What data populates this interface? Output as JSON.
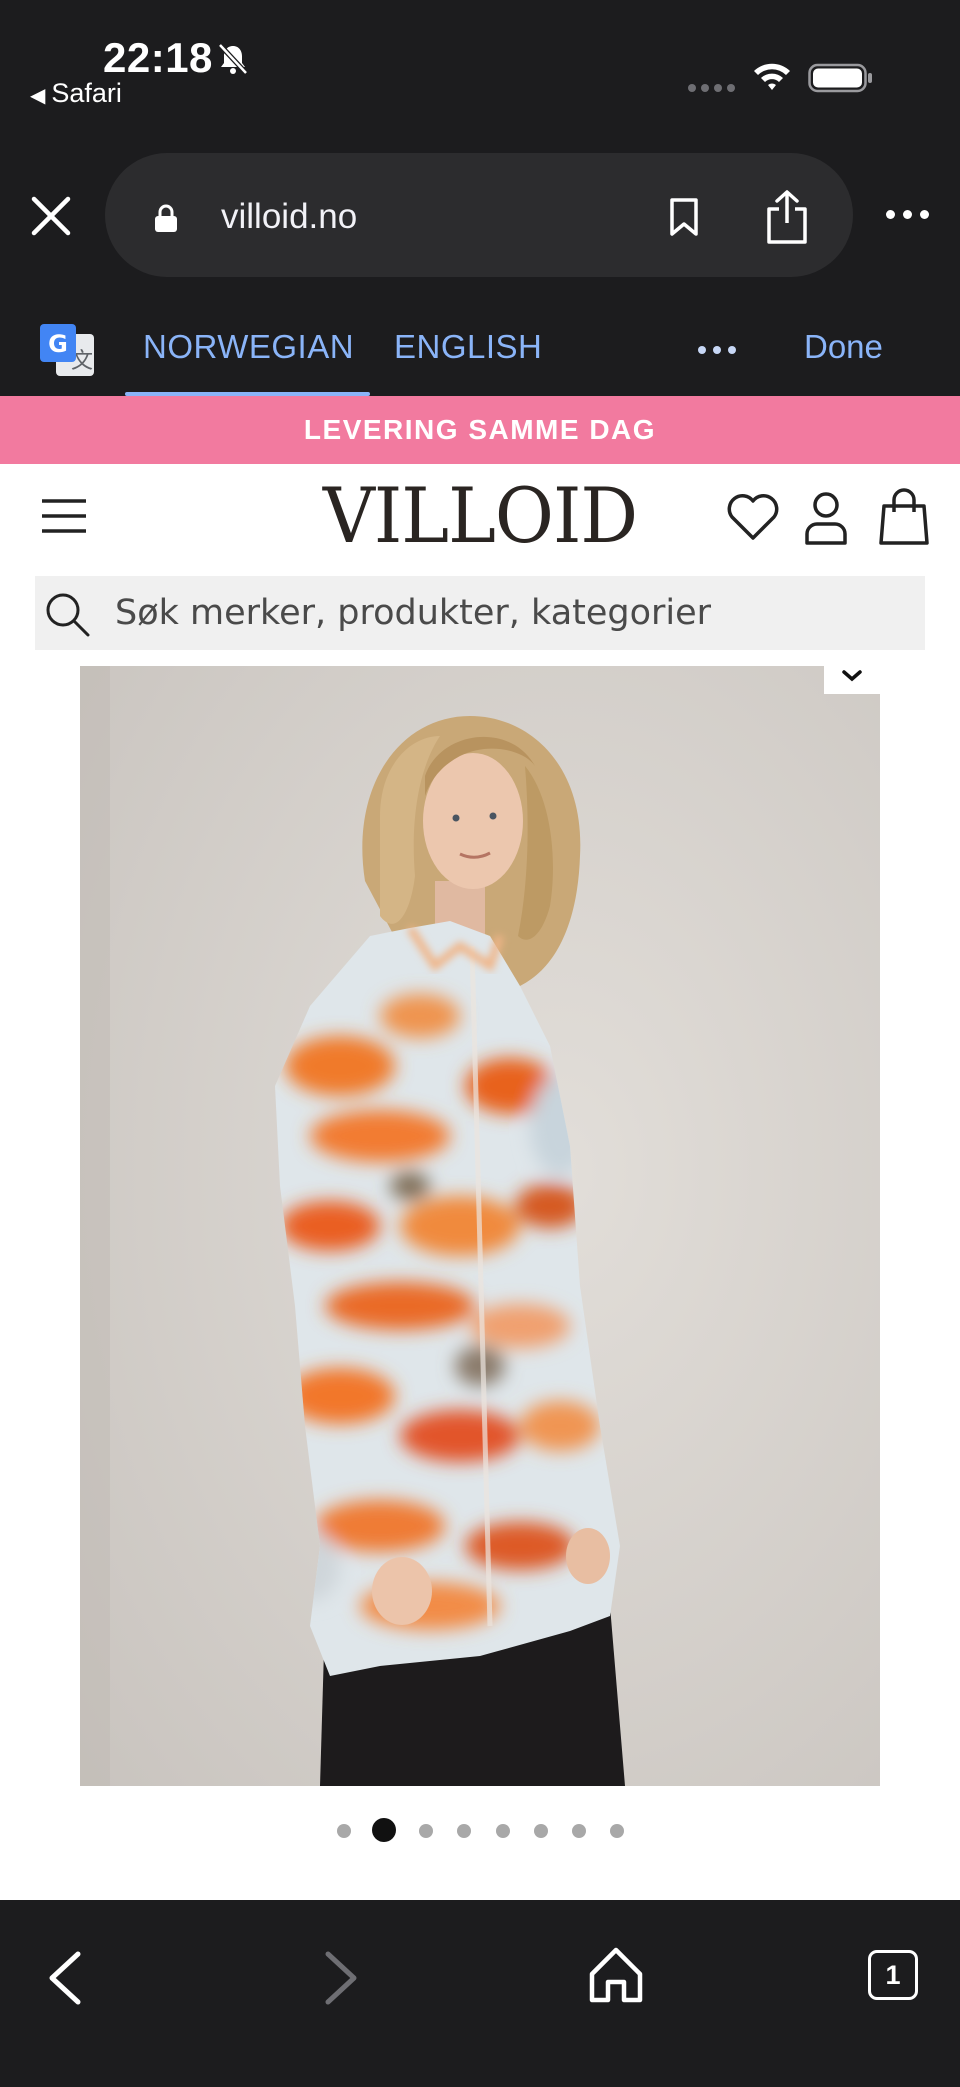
{
  "status_bar": {
    "time": "22:18",
    "back_app_label": "Safari"
  },
  "browser": {
    "url": "villoid.no",
    "open_tabs_count": "1"
  },
  "translate_bar": {
    "source_language": "NORWEGIAN",
    "target_language": "ENGLISH",
    "done_label": "Done"
  },
  "site": {
    "promo_banner": "LEVERING SAMME DAG",
    "logo": "VILLOID",
    "search_placeholder": "Søk merker, produkter, kategorier"
  },
  "product": {
    "image_description_icon": "woman-in-orange-blurred-print-shirt",
    "carousel": {
      "total_slides": 8,
      "active_index": 1
    }
  },
  "colors": {
    "chrome_background": "#1c1c1e",
    "url_pill": "#2c2c2e",
    "translate_accent": "#8ab4f8",
    "promo_pink": "#f27a9f",
    "logo_text": "#2a2522"
  },
  "icons": [
    "silent-bell-icon",
    "wifi-icon",
    "battery-icon",
    "close-icon",
    "lock-icon",
    "bookmark-icon",
    "share-icon",
    "more-icon",
    "google-translate-icon",
    "menu-icon",
    "heart-icon",
    "account-icon",
    "shopping-bag-icon",
    "search-icon",
    "chevron-down-icon",
    "back-arrow-icon",
    "forward-arrow-icon",
    "home-icon",
    "tabs-icon"
  ]
}
